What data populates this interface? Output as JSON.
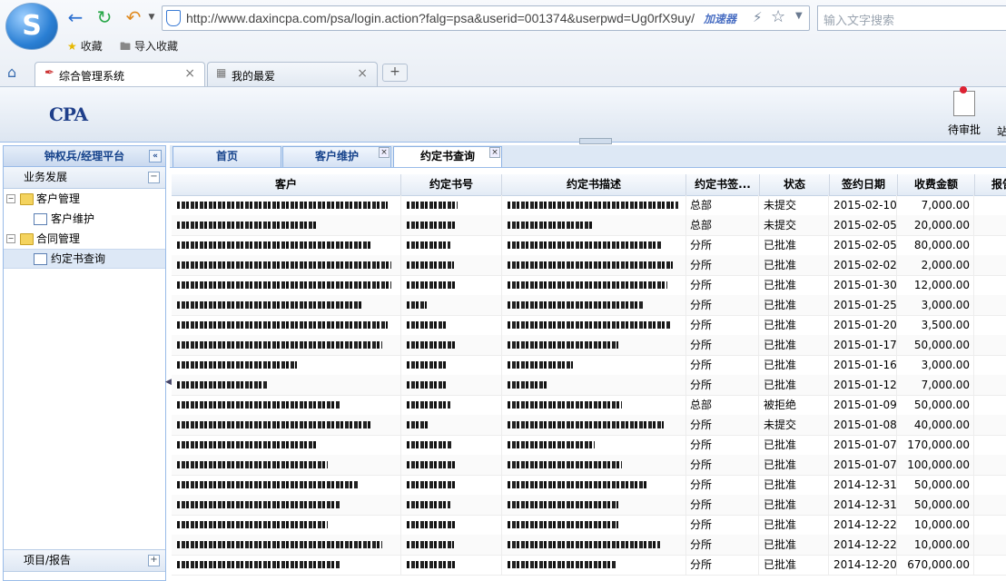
{
  "browser": {
    "url": "http://www.daxincpa.com/psa/login.action?falg=psa&userid=001374&userpwd=Ug0rfX9uy/",
    "accelerator_label": "加速器",
    "search_placeholder": "输入文字搜索",
    "bookmarks": [
      {
        "label": "收藏"
      },
      {
        "label": "导入收藏"
      }
    ],
    "tabs": [
      {
        "label": "综合管理系统"
      },
      {
        "label": "我的最爱"
      }
    ]
  },
  "app": {
    "logo_text": "CPA",
    "toolbar": {
      "approve_label": "待审批",
      "partial_label": "站"
    },
    "west": {
      "title": "钟权兵/经理平台",
      "sections": [
        {
          "label": "业务发展"
        },
        {
          "label": "项目/报告"
        }
      ],
      "tree": [
        {
          "label": "客户管理"
        },
        {
          "label": "客户维护"
        },
        {
          "label": "合同管理"
        },
        {
          "label": "约定书查询"
        }
      ]
    },
    "tabs": [
      {
        "label": "首页"
      },
      {
        "label": "客户维护"
      },
      {
        "label": "约定书查询"
      }
    ],
    "grid": {
      "columns": [
        {
          "label": "客户"
        },
        {
          "label": "约定书号"
        },
        {
          "label": "约定书描述"
        },
        {
          "label": "约定书签..."
        },
        {
          "label": "状态"
        },
        {
          "label": "签约日期"
        },
        {
          "label": "收费金额"
        },
        {
          "label": "报告"
        }
      ],
      "rows": [
        {
          "dept": "总部",
          "status": "未提交",
          "date": "2015-02-10",
          "amount": "7,000.00",
          "w": [
            232,
            56,
            188
          ]
        },
        {
          "dept": "总部",
          "status": "未提交",
          "date": "2015-02-05",
          "amount": "20,000.00",
          "w": [
            155,
            54,
            95
          ]
        },
        {
          "dept": "分所",
          "status": "已批准",
          "date": "2015-02-05",
          "amount": "80,000.00",
          "w": [
            215,
            48,
            170
          ]
        },
        {
          "dept": "分所",
          "status": "已批准",
          "date": "2015-02-02",
          "amount": "2,000.00",
          "w": [
            236,
            52,
            182
          ]
        },
        {
          "dept": "分所",
          "status": "已批准",
          "date": "2015-01-30",
          "amount": "12,000.00",
          "w": [
            236,
            54,
            176
          ]
        },
        {
          "dept": "分所",
          "status": "已批准",
          "date": "2015-01-25",
          "amount": "3,000.00",
          "w": [
            205,
            22,
            150
          ]
        },
        {
          "dept": "分所",
          "status": "已批准",
          "date": "2015-01-20",
          "amount": "3,500.00",
          "w": [
            232,
            44,
            180
          ]
        },
        {
          "dept": "分所",
          "status": "已批准",
          "date": "2015-01-17",
          "amount": "50,000.00",
          "w": [
            226,
            54,
            122
          ]
        },
        {
          "dept": "分所",
          "status": "已批准",
          "date": "2015-01-16",
          "amount": "3,000.00",
          "w": [
            132,
            44,
            72
          ]
        },
        {
          "dept": "分所",
          "status": "已批准",
          "date": "2015-01-12",
          "amount": "7,000.00",
          "w": [
            100,
            44,
            44
          ]
        },
        {
          "dept": "总部",
          "status": "被拒绝",
          "date": "2015-01-09",
          "amount": "50,000.00",
          "w": [
            180,
            48,
            126
          ]
        },
        {
          "dept": "分所",
          "status": "未提交",
          "date": "2015-01-08",
          "amount": "40,000.00",
          "w": [
            215,
            24,
            172
          ]
        },
        {
          "dept": "分所",
          "status": "已批准",
          "date": "2015-01-07",
          "amount": "170,000.00",
          "w": [
            155,
            50,
            96
          ]
        },
        {
          "dept": "分所",
          "status": "已批准",
          "date": "2015-01-07",
          "amount": "100,000.00",
          "w": [
            166,
            54,
            126
          ]
        },
        {
          "dept": "分所",
          "status": "已批准",
          "date": "2014-12-31",
          "amount": "50,000.00",
          "w": [
            200,
            54,
            154
          ]
        },
        {
          "dept": "分所",
          "status": "已批准",
          "date": "2014-12-31",
          "amount": "50,000.00",
          "w": [
            180,
            48,
            122
          ]
        },
        {
          "dept": "分所",
          "status": "已批准",
          "date": "2014-12-22",
          "amount": "10,000.00",
          "w": [
            166,
            54,
            122
          ]
        },
        {
          "dept": "分所",
          "status": "已批准",
          "date": "2014-12-22",
          "amount": "10,000.00",
          "w": [
            226,
            52,
            168
          ]
        },
        {
          "dept": "分所",
          "status": "已批准",
          "date": "2014-12-20",
          "amount": "670,000.00",
          "w": [
            180,
            54,
            120
          ]
        }
      ]
    }
  }
}
